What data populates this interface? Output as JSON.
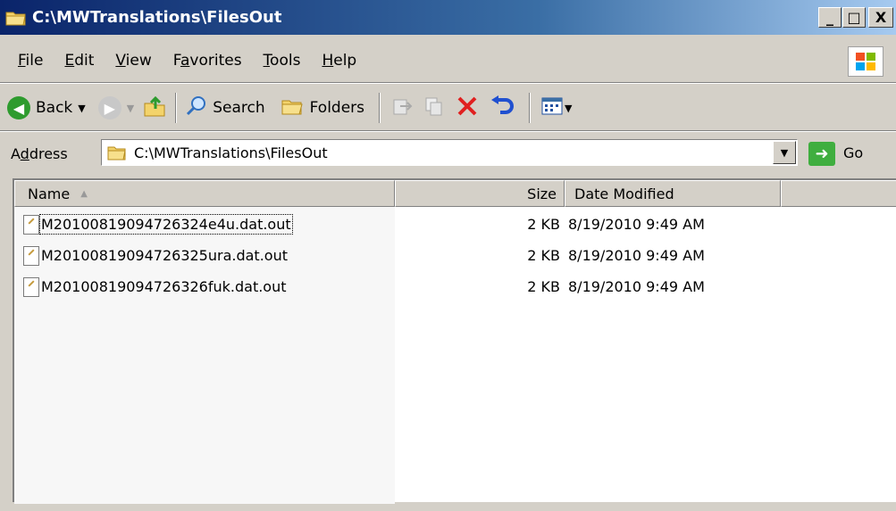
{
  "window": {
    "title": "C:\\MWTranslations\\FilesOut",
    "controls": [
      "_",
      "□",
      "X"
    ]
  },
  "menu": {
    "items": [
      {
        "pre": "",
        "accel": "F",
        "post": "ile"
      },
      {
        "pre": "",
        "accel": "E",
        "post": "dit"
      },
      {
        "pre": "",
        "accel": "V",
        "post": "iew"
      },
      {
        "pre": "F",
        "accel": "a",
        "post": "vorites"
      },
      {
        "pre": "",
        "accel": "T",
        "post": "ools"
      },
      {
        "pre": "",
        "accel": "H",
        "post": "elp"
      }
    ]
  },
  "toolbar": {
    "back_label": "Back",
    "search_label": "Search",
    "folders_label": "Folders"
  },
  "address": {
    "label": "Address",
    "accel": "d",
    "value": "C:\\MWTranslations\\FilesOut",
    "go_label": "Go"
  },
  "columns": {
    "name": "Name",
    "size": "Size",
    "date": "Date Modified"
  },
  "files": [
    {
      "name": "M20100819094726324e4u.dat.out",
      "size": "2 KB",
      "date": "8/19/2010 9:49 AM"
    },
    {
      "name": "M20100819094726325ura.dat.out",
      "size": "2 KB",
      "date": "8/19/2010 9:49 AM"
    },
    {
      "name": "M20100819094726326fuk.dat.out",
      "size": "2 KB",
      "date": "8/19/2010 9:49 AM"
    }
  ],
  "colors": {
    "titlebar_start": "#0a246a",
    "titlebar_end": "#a6caf0",
    "chrome": "#d4d0c8",
    "delete_red": "#e02020",
    "go_green": "#3fae3f"
  }
}
